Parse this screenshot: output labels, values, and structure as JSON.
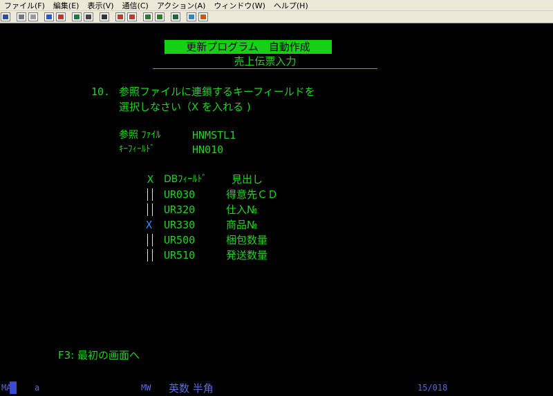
{
  "menu": {
    "items": [
      "ファイル(F)",
      "編集(E)",
      "表示(V)",
      "通信(C)",
      "アクション(A)",
      "ウィンドウ(W)",
      "ヘルプ(H)"
    ]
  },
  "toolbar": {
    "icons": [
      "print-screen-icon",
      "copy-icon",
      "paste-icon",
      "send-file-icon",
      "receive-file-icon",
      "display-setup-icon",
      "keyboard-icon",
      "macro-record-icon",
      "macro-play-icon",
      "macro-icon",
      "record-icon",
      "play-icon",
      "manual-icon",
      "color-icon",
      "edit-icon"
    ]
  },
  "screen": {
    "title": "更新プログラム　自動作成",
    "subtitle": "売上伝票入力",
    "instruction_number": "10.",
    "instruction_line1": "参照ファイルに連鎖するキーフィールドを",
    "instruction_line2": "選択しなさい（X を入れる )",
    "ref_file_label": "参照 ﾌｧｲﾙ",
    "ref_file_value": "HNMSTL1",
    "key_field_label": "ｷｰﾌｨｰﾙﾄﾞ",
    "key_field_value": "HN010",
    "table": {
      "col_select": "X",
      "col_field": "DBﾌｨｰﾙﾄﾞ",
      "col_heading": "見出し",
      "rows": [
        {
          "select": "",
          "field": "UR030",
          "heading": "得意先ＣＤ"
        },
        {
          "select": "",
          "field": "UR320",
          "heading": "仕入№"
        },
        {
          "select": "X",
          "field": "UR330",
          "heading": "商品№"
        },
        {
          "select": "",
          "field": "UR500",
          "heading": "梱包数量"
        },
        {
          "select": "",
          "field": "UR510",
          "heading": "発送数量"
        }
      ]
    },
    "function_key": "F3: 最初の画面へ"
  },
  "status": {
    "session": "MA",
    "mode": "a",
    "mw": "MW",
    "input_mode": "英数 半角",
    "cursor_pos": "15/018"
  },
  "colors": {
    "foreground": "#22d322",
    "background": "#000000",
    "title_bg": "#16d016",
    "status_text": "#5a6ad8"
  }
}
